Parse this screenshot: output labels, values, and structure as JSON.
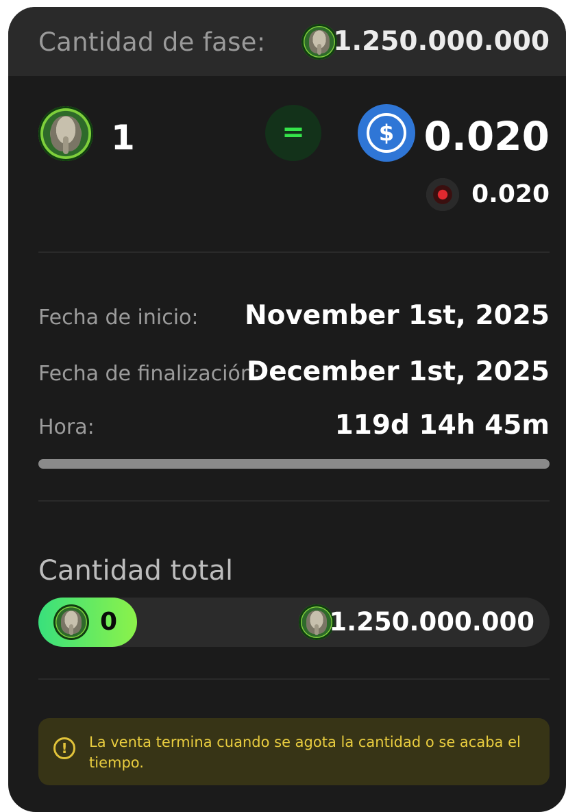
{
  "phase": {
    "label": "Cantidad de fase:",
    "amount": "1.250.000.000",
    "token_icon": "elephant-coin-icon"
  },
  "rate": {
    "token_amount": "1",
    "equals_symbol": "=",
    "usdc_icon_symbol": "$",
    "usdc_price": "0.020",
    "secondary_price": "0.020",
    "secondary_icon": "alt-token-icon"
  },
  "info": {
    "start_label": "Fecha de inicio:",
    "start_value": "November 1st, 2025",
    "end_label": "Fecha de finalización:",
    "end_value": "December 1st, 2025",
    "time_label": "Hora:",
    "time_value": "119d 14h 45m",
    "time_progress": 0
  },
  "total": {
    "label": "Cantidad total",
    "sold": "0",
    "max": "1.250.000.000"
  },
  "notice": {
    "icon_symbol": "!",
    "text": "La venta termina cuando se agota la cantidad o se acaba el tiempo."
  },
  "colors": {
    "accent_green": "#3fe26b",
    "usdc_blue": "#2f76d6",
    "warning_yellow": "#e9cd3f"
  }
}
